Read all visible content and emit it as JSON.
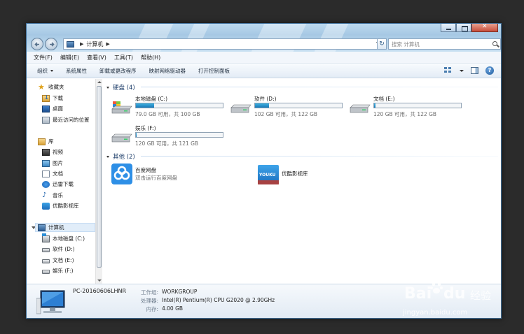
{
  "address": {
    "crumb": "计算机"
  },
  "search": {
    "placeholder": "搜索 计算机"
  },
  "menu": [
    "文件(F)",
    "编辑(E)",
    "查看(V)",
    "工具(T)",
    "帮助(H)"
  ],
  "toolbar": {
    "organize": "组织",
    "system_properties": "系统属性",
    "uninstall": "卸载或更改程序",
    "map_drive": "映射网络驱动器",
    "control_panel": "打开控制面板"
  },
  "nav": {
    "favorites": "收藏夹",
    "downloads": "下载",
    "desktop": "桌面",
    "recent": "最近访问的位置",
    "libraries": "库",
    "videos": "视频",
    "pictures": "图片",
    "documents": "文档",
    "thunder": "迅雷下载",
    "music": "音乐",
    "youku_lib": "优酷影视库",
    "computer": "计算机",
    "drive_c": "本地磁盘 (C:)",
    "drive_d": "软件 (D:)",
    "drive_e": "文档 (E:)",
    "drive_f": "娱乐 (F:)"
  },
  "groups": {
    "hdd": "硬盘 (4)",
    "other": "其他 (2)"
  },
  "drives": [
    {
      "name": "本地磁盘 (C:)",
      "info": "79.0 GB 可用，共 100 GB",
      "used_fraction": 0.21
    },
    {
      "name": "软件 (D:)",
      "info": "102 GB 可用，共 122 GB",
      "used_fraction": 0.16
    },
    {
      "name": "文档 (E:)",
      "info": "120 GB 可用，共 122 GB",
      "used_fraction": 0.02
    },
    {
      "name": "娱乐 (F:)",
      "info": "120 GB 可用，共 121 GB",
      "used_fraction": 0.01
    }
  ],
  "others": [
    {
      "name": "百度网盘",
      "sub": "双击运行百度网盘"
    },
    {
      "name": "优酷影视库",
      "sub": "",
      "badge": "YOUKU"
    }
  ],
  "details": {
    "pc_name": "PC-20160606LHNR",
    "workgroup_label": "工作组:",
    "workgroup": "WORKGROUP",
    "cpu_label": "处理器:",
    "cpu": "Intel(R) Pentium(R) CPU G2020 @ 2.90GHz",
    "mem_label": "内存:",
    "mem": "4.00 GB"
  },
  "watermark": {
    "brand": "Bai",
    "brand2": "du",
    "cn": "经验",
    "url": "jingyan.baidu.com"
  }
}
